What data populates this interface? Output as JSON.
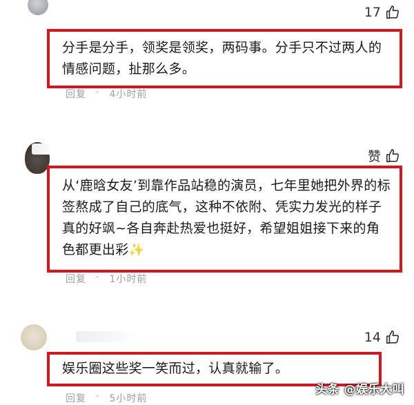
{
  "comments": [
    {
      "text": "分手是分手，领奖是领奖，两码事。分手只不过两人的情感问题，扯那么多。",
      "likes": "17",
      "reply_label": "回复",
      "dot": "·",
      "time": "4小时前"
    },
    {
      "text": "从‘鹿晗女友’到靠作品站稳的演员，七年里她把外界的标签熬成了自己的底气，这种不依附、凭实力发光的样子真的好飒~各自奔赴热爱也挺好，希望姐姐接下来的角色都更出彩",
      "likes": "赞",
      "emoji": "✨",
      "reply_label": "回复",
      "dot": "·",
      "time": "1小时前"
    },
    {
      "text": "娱乐圈这些奖一笑而过，认真就输了。",
      "likes": "14",
      "reply_label": "回复",
      "dot": "·",
      "time": "5小时前"
    }
  ],
  "watermark": "头条 @娱乐大叫",
  "colors": {
    "highlight_border": "#d8141c",
    "meta_text": "#9aa0a6"
  },
  "icons": {
    "like": "thumbs-up-icon"
  }
}
